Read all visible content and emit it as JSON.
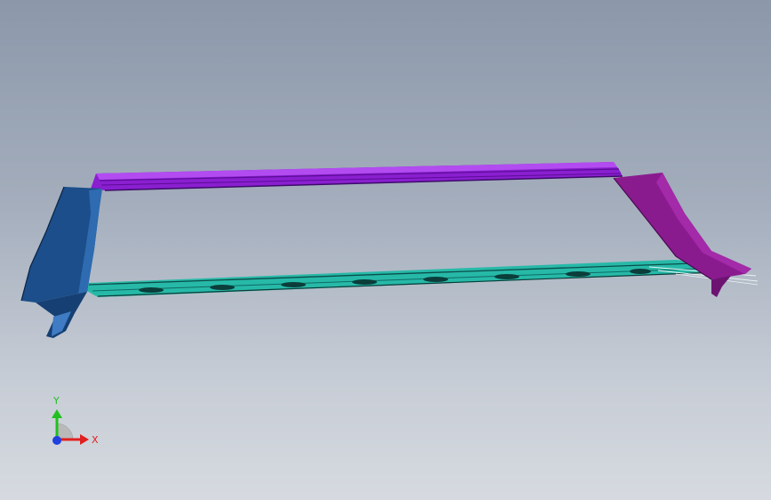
{
  "viewport": {
    "background_top": "#8c98aa",
    "background_bottom": "#d6dae0"
  },
  "model": {
    "parts": [
      {
        "name": "left-pillar",
        "color": "#1b4e8a"
      },
      {
        "name": "top-rail",
        "color": "#8a1fd0"
      },
      {
        "name": "right-pillar",
        "color": "#8a1b8f"
      },
      {
        "name": "bottom-rail",
        "color": "#27b9a8"
      }
    ]
  },
  "triad": {
    "x_label": "X",
    "y_label": "Y",
    "x_color": "#e02020",
    "y_color": "#20c020",
    "z_color": "#2040e0"
  }
}
